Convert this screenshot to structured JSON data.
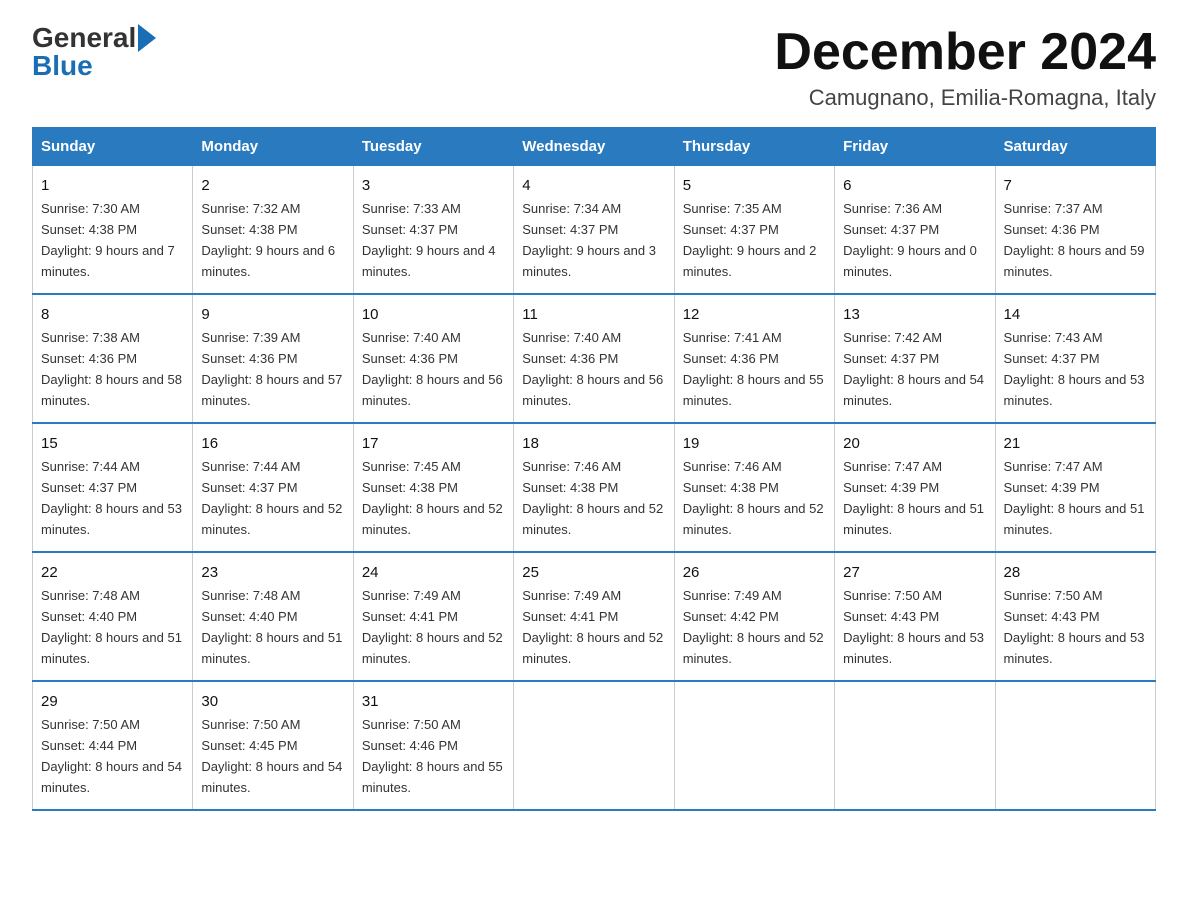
{
  "logo": {
    "general": "General",
    "blue": "Blue"
  },
  "header": {
    "month_year": "December 2024",
    "location": "Camugnano, Emilia-Romagna, Italy"
  },
  "days_of_week": [
    "Sunday",
    "Monday",
    "Tuesday",
    "Wednesday",
    "Thursday",
    "Friday",
    "Saturday"
  ],
  "weeks": [
    [
      {
        "day": "1",
        "sunrise": "7:30 AM",
        "sunset": "4:38 PM",
        "daylight": "9 hours and 7 minutes."
      },
      {
        "day": "2",
        "sunrise": "7:32 AM",
        "sunset": "4:38 PM",
        "daylight": "9 hours and 6 minutes."
      },
      {
        "day": "3",
        "sunrise": "7:33 AM",
        "sunset": "4:37 PM",
        "daylight": "9 hours and 4 minutes."
      },
      {
        "day": "4",
        "sunrise": "7:34 AM",
        "sunset": "4:37 PM",
        "daylight": "9 hours and 3 minutes."
      },
      {
        "day": "5",
        "sunrise": "7:35 AM",
        "sunset": "4:37 PM",
        "daylight": "9 hours and 2 minutes."
      },
      {
        "day": "6",
        "sunrise": "7:36 AM",
        "sunset": "4:37 PM",
        "daylight": "9 hours and 0 minutes."
      },
      {
        "day": "7",
        "sunrise": "7:37 AM",
        "sunset": "4:36 PM",
        "daylight": "8 hours and 59 minutes."
      }
    ],
    [
      {
        "day": "8",
        "sunrise": "7:38 AM",
        "sunset": "4:36 PM",
        "daylight": "8 hours and 58 minutes."
      },
      {
        "day": "9",
        "sunrise": "7:39 AM",
        "sunset": "4:36 PM",
        "daylight": "8 hours and 57 minutes."
      },
      {
        "day": "10",
        "sunrise": "7:40 AM",
        "sunset": "4:36 PM",
        "daylight": "8 hours and 56 minutes."
      },
      {
        "day": "11",
        "sunrise": "7:40 AM",
        "sunset": "4:36 PM",
        "daylight": "8 hours and 56 minutes."
      },
      {
        "day": "12",
        "sunrise": "7:41 AM",
        "sunset": "4:36 PM",
        "daylight": "8 hours and 55 minutes."
      },
      {
        "day": "13",
        "sunrise": "7:42 AM",
        "sunset": "4:37 PM",
        "daylight": "8 hours and 54 minutes."
      },
      {
        "day": "14",
        "sunrise": "7:43 AM",
        "sunset": "4:37 PM",
        "daylight": "8 hours and 53 minutes."
      }
    ],
    [
      {
        "day": "15",
        "sunrise": "7:44 AM",
        "sunset": "4:37 PM",
        "daylight": "8 hours and 53 minutes."
      },
      {
        "day": "16",
        "sunrise": "7:44 AM",
        "sunset": "4:37 PM",
        "daylight": "8 hours and 52 minutes."
      },
      {
        "day": "17",
        "sunrise": "7:45 AM",
        "sunset": "4:38 PM",
        "daylight": "8 hours and 52 minutes."
      },
      {
        "day": "18",
        "sunrise": "7:46 AM",
        "sunset": "4:38 PM",
        "daylight": "8 hours and 52 minutes."
      },
      {
        "day": "19",
        "sunrise": "7:46 AM",
        "sunset": "4:38 PM",
        "daylight": "8 hours and 52 minutes."
      },
      {
        "day": "20",
        "sunrise": "7:47 AM",
        "sunset": "4:39 PM",
        "daylight": "8 hours and 51 minutes."
      },
      {
        "day": "21",
        "sunrise": "7:47 AM",
        "sunset": "4:39 PM",
        "daylight": "8 hours and 51 minutes."
      }
    ],
    [
      {
        "day": "22",
        "sunrise": "7:48 AM",
        "sunset": "4:40 PM",
        "daylight": "8 hours and 51 minutes."
      },
      {
        "day": "23",
        "sunrise": "7:48 AM",
        "sunset": "4:40 PM",
        "daylight": "8 hours and 51 minutes."
      },
      {
        "day": "24",
        "sunrise": "7:49 AM",
        "sunset": "4:41 PM",
        "daylight": "8 hours and 52 minutes."
      },
      {
        "day": "25",
        "sunrise": "7:49 AM",
        "sunset": "4:41 PM",
        "daylight": "8 hours and 52 minutes."
      },
      {
        "day": "26",
        "sunrise": "7:49 AM",
        "sunset": "4:42 PM",
        "daylight": "8 hours and 52 minutes."
      },
      {
        "day": "27",
        "sunrise": "7:50 AM",
        "sunset": "4:43 PM",
        "daylight": "8 hours and 53 minutes."
      },
      {
        "day": "28",
        "sunrise": "7:50 AM",
        "sunset": "4:43 PM",
        "daylight": "8 hours and 53 minutes."
      }
    ],
    [
      {
        "day": "29",
        "sunrise": "7:50 AM",
        "sunset": "4:44 PM",
        "daylight": "8 hours and 54 minutes."
      },
      {
        "day": "30",
        "sunrise": "7:50 AM",
        "sunset": "4:45 PM",
        "daylight": "8 hours and 54 minutes."
      },
      {
        "day": "31",
        "sunrise": "7:50 AM",
        "sunset": "4:46 PM",
        "daylight": "8 hours and 55 minutes."
      },
      null,
      null,
      null,
      null
    ]
  ]
}
